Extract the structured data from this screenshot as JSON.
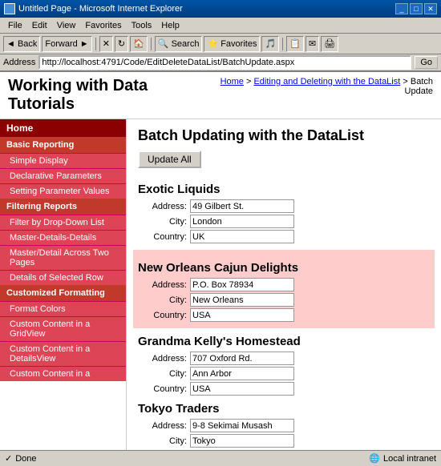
{
  "browser": {
    "title": "Untitled Page - Microsoft Internet Explorer",
    "menu_items": [
      "File",
      "Edit",
      "View",
      "Favorites",
      "Tools",
      "Help"
    ],
    "address_label": "Address",
    "address_url": "http://localhost:4791/Code/EditDeleteDataList/BatchUpdate.aspx",
    "go_button": "Go",
    "status_left": "Done",
    "status_right": "Local intranet",
    "toolbar_buttons": [
      "Back",
      "Forward",
      "Stop",
      "Refresh",
      "Home",
      "Search",
      "Favorites",
      "Media",
      "History"
    ]
  },
  "page": {
    "title": "Working with Data Tutorials",
    "breadcrumb": {
      "home": "Home",
      "parent": "Editing and Deleting with the DataList",
      "current": "Batch Update"
    },
    "heading": "Batch Updating with the DataList",
    "update_all": "Update All"
  },
  "sidebar": {
    "home": "Home",
    "sections": [
      {
        "label": "Basic Reporting",
        "items": [
          "Simple Display",
          "Declarative Parameters",
          "Setting Parameter Values"
        ]
      },
      {
        "label": "Filtering Reports",
        "items": [
          "Filter by Drop-Down List",
          "Master-Details-Details",
          "Master/Detail Across Two Pages",
          "Details of Selected Row"
        ]
      },
      {
        "label": "Customized Formatting",
        "items": [
          "Format Colors",
          "Custom Content in a GridView",
          "Custom Content in a DetailsView",
          "Custom Content in a"
        ]
      }
    ]
  },
  "companies": [
    {
      "name": "Exotic Liquids",
      "highlighted": false,
      "address": "49 Gilbert St.",
      "city": "London",
      "country": "UK"
    },
    {
      "name": "New Orleans Cajun Delights",
      "highlighted": true,
      "address": "P.O. Box 78934",
      "city": "New Orleans",
      "country": "USA"
    },
    {
      "name": "Grandma Kelly's Homestead",
      "highlighted": false,
      "address": "707 Oxford Rd.",
      "city": "Ann Arbor",
      "country": "USA"
    },
    {
      "name": "Tokyo Traders",
      "highlighted": false,
      "address": "9-8 Sekimai Musash",
      "city": "Tokyo",
      "country": ""
    }
  ],
  "labels": {
    "address": "Address:",
    "city": "City:",
    "country": "Country:"
  },
  "colors": {
    "sidebar_dark": "#8b0000",
    "sidebar_mid": "#c0392b",
    "sidebar_item": "#cc4444",
    "highlight_bg": "#ffcccc",
    "accent": "#0000cc"
  }
}
